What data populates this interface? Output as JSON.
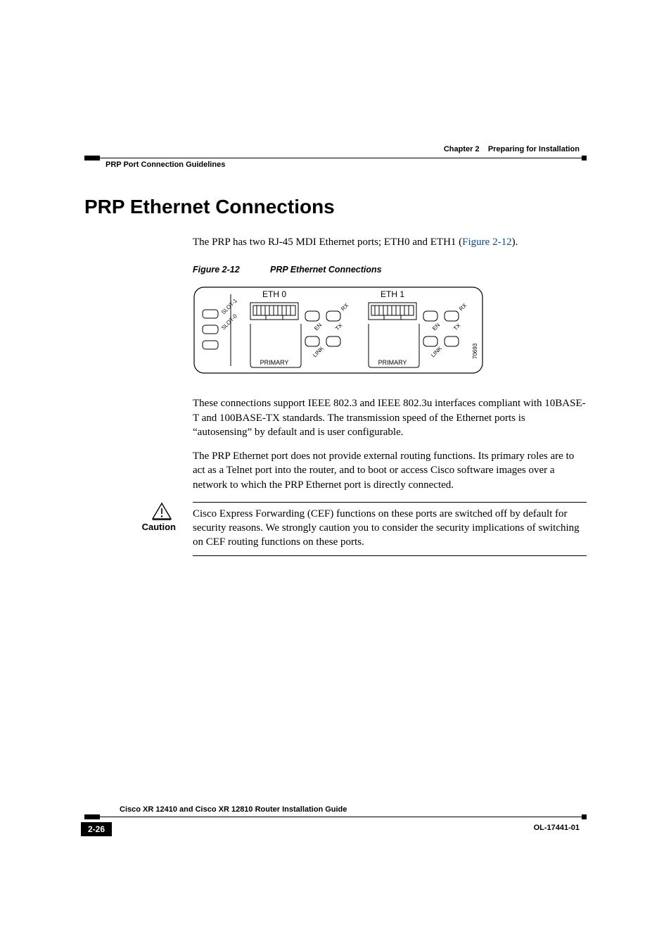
{
  "header": {
    "chapter_label": "Chapter 2",
    "chapter_title": "Preparing for Installation",
    "section": "PRP Port Connection Guidelines"
  },
  "content": {
    "h1": "PRP Ethernet Connections",
    "intro_pre": "The PRP has two RJ-45 MDI Ethernet ports; ETH0 and ETH1 (",
    "intro_link": "Figure 2-12",
    "intro_post": ").",
    "fig_num": "Figure 2-12",
    "fig_title": "PRP Ethernet Connections",
    "fig_labels": {
      "eth0": "ETH 0",
      "eth1": "ETH 1",
      "slot1": "SLOT-1",
      "slot0": "SLOT-0",
      "primary": "PRIMARY",
      "link": "LINK",
      "en": "EN",
      "tx": "TX",
      "rx": "RX",
      "id": "70693"
    },
    "para2": "These connections support IEEE 802.3 and IEEE 802.3u interfaces compliant with 10BASE-T and 100BASE-TX standards. The transmission speed of the Ethernet ports is “autosensing” by default and is user configurable.",
    "para3": "The PRP Ethernet port does not provide external routing functions. Its primary roles are to act as a Telnet port into the router, and to boot or access Cisco software images over a network to which the PRP Ethernet port is directly connected.",
    "caution_label": "Caution",
    "caution_body": "Cisco Express Forwarding (CEF) functions on these ports are switched off by default for security reasons. We strongly caution you to consider the security implications of switching on CEF routing functions on these ports."
  },
  "footer": {
    "doc_title": "Cisco XR 12410 and Cisco XR 12810 Router Installation Guide",
    "page": "2-26",
    "doc_id": "OL-17441-01"
  }
}
